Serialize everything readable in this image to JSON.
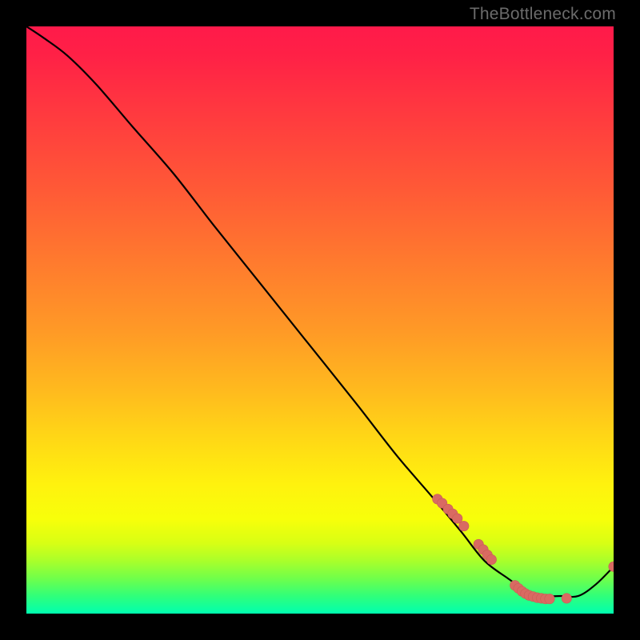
{
  "attribution": "TheBottleneck.com",
  "colors": {
    "background": "#000000",
    "curve": "#000000",
    "marker_fill": "#d96a62",
    "marker_stroke": "#c95c55"
  },
  "chart_data": {
    "type": "line",
    "title": "",
    "xlabel": "",
    "ylabel": "",
    "xlim": [
      0,
      100
    ],
    "ylim": [
      0,
      100
    ],
    "grid": false,
    "legend": null,
    "series": [
      {
        "name": "bottleneck-curve",
        "x": [
          0,
          3,
          7,
          12,
          18,
          25,
          32,
          40,
          48,
          56,
          63,
          69,
          74,
          78,
          82,
          85,
          88,
          91,
          94,
          97,
          100
        ],
        "y": [
          100,
          98,
          95,
          90,
          83,
          75,
          66,
          56,
          46,
          36,
          27,
          20,
          14,
          9,
          6,
          4,
          3,
          3,
          3,
          5,
          8
        ]
      }
    ],
    "markers": [
      {
        "x": 70.0,
        "y": 19.5
      },
      {
        "x": 70.8,
        "y": 18.8
      },
      {
        "x": 71.8,
        "y": 17.8
      },
      {
        "x": 72.6,
        "y": 17.0
      },
      {
        "x": 73.4,
        "y": 16.2
      },
      {
        "x": 74.5,
        "y": 14.9
      },
      {
        "x": 77.0,
        "y": 11.8
      },
      {
        "x": 77.8,
        "y": 10.9
      },
      {
        "x": 78.5,
        "y": 10.0
      },
      {
        "x": 79.2,
        "y": 9.2
      },
      {
        "x": 83.2,
        "y": 4.8
      },
      {
        "x": 83.8,
        "y": 4.3
      },
      {
        "x": 84.4,
        "y": 3.8
      },
      {
        "x": 85.0,
        "y": 3.4
      },
      {
        "x": 85.6,
        "y": 3.1
      },
      {
        "x": 86.3,
        "y": 2.9
      },
      {
        "x": 87.0,
        "y": 2.7
      },
      {
        "x": 87.7,
        "y": 2.6
      },
      {
        "x": 88.4,
        "y": 2.5
      },
      {
        "x": 89.1,
        "y": 2.5
      },
      {
        "x": 92.0,
        "y": 2.6
      },
      {
        "x": 100.0,
        "y": 8.0
      }
    ]
  }
}
